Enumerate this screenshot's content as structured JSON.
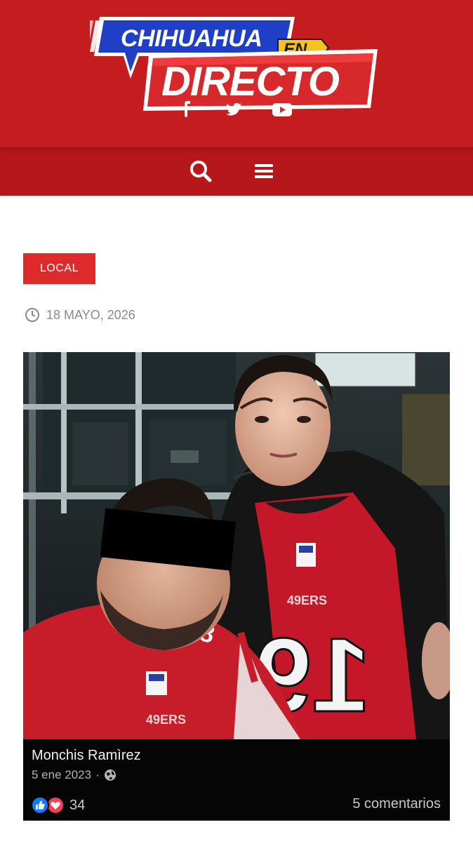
{
  "header": {
    "logo": {
      "line1": "CHIHUAHUA",
      "line2": "EN",
      "line3": "DIRECTO"
    },
    "social_icons": [
      "facebook-icon",
      "twitter-icon",
      "youtube-icon"
    ],
    "nav_icons": [
      "search-icon",
      "hamburger-menu-icon"
    ]
  },
  "article": {
    "category": "LOCAL",
    "date": "18 MAYO, 2026"
  },
  "post": {
    "author": "Monchis Ramìrez",
    "date": "5 ene 2023",
    "separator": "·",
    "reaction_count": "34",
    "comments": "5 comentarios",
    "jersey_number": "19"
  },
  "colors": {
    "header_red": "#c41c1f",
    "nav_red": "#b5171a",
    "badge_red": "#dd2a2a",
    "logo_blue": "#1f3fc6",
    "logo_yellow": "#f7c21a"
  }
}
